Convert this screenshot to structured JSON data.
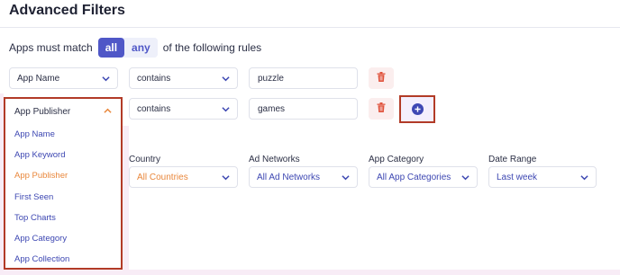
{
  "title": "Advanced Filters",
  "match": {
    "prefix": "Apps must match",
    "all": "all",
    "any": "any",
    "suffix": "of the following rules"
  },
  "rules": [
    {
      "field": "App Name",
      "operator": "contains",
      "value": "puzzle"
    },
    {
      "field": "App Publisher",
      "operator": "contains",
      "value": "games"
    }
  ],
  "dropdown": {
    "items": [
      "App Name",
      "App Keyword",
      "App Publisher",
      "First Seen",
      "Top Charts",
      "App Category",
      "App Collection"
    ],
    "selected": "App Publisher"
  },
  "filters": {
    "country": {
      "label": "Country",
      "value": "All Countries"
    },
    "ad_networks": {
      "label": "Ad Networks",
      "value": "All Ad Networks"
    },
    "app_category": {
      "label": "App Category",
      "value": "All App Categories"
    },
    "date_range": {
      "label": "Date Range",
      "value": "Last week"
    }
  },
  "colors": {
    "accent": "#4f57c7",
    "highlight": "#b23b27",
    "orange": "#e9873b",
    "danger": "#e0533d"
  },
  "icons": {
    "chevron": "chevron-down-icon",
    "chevron_up": "chevron-up-icon",
    "trash": "trash-icon",
    "add": "plus-circle-icon"
  }
}
